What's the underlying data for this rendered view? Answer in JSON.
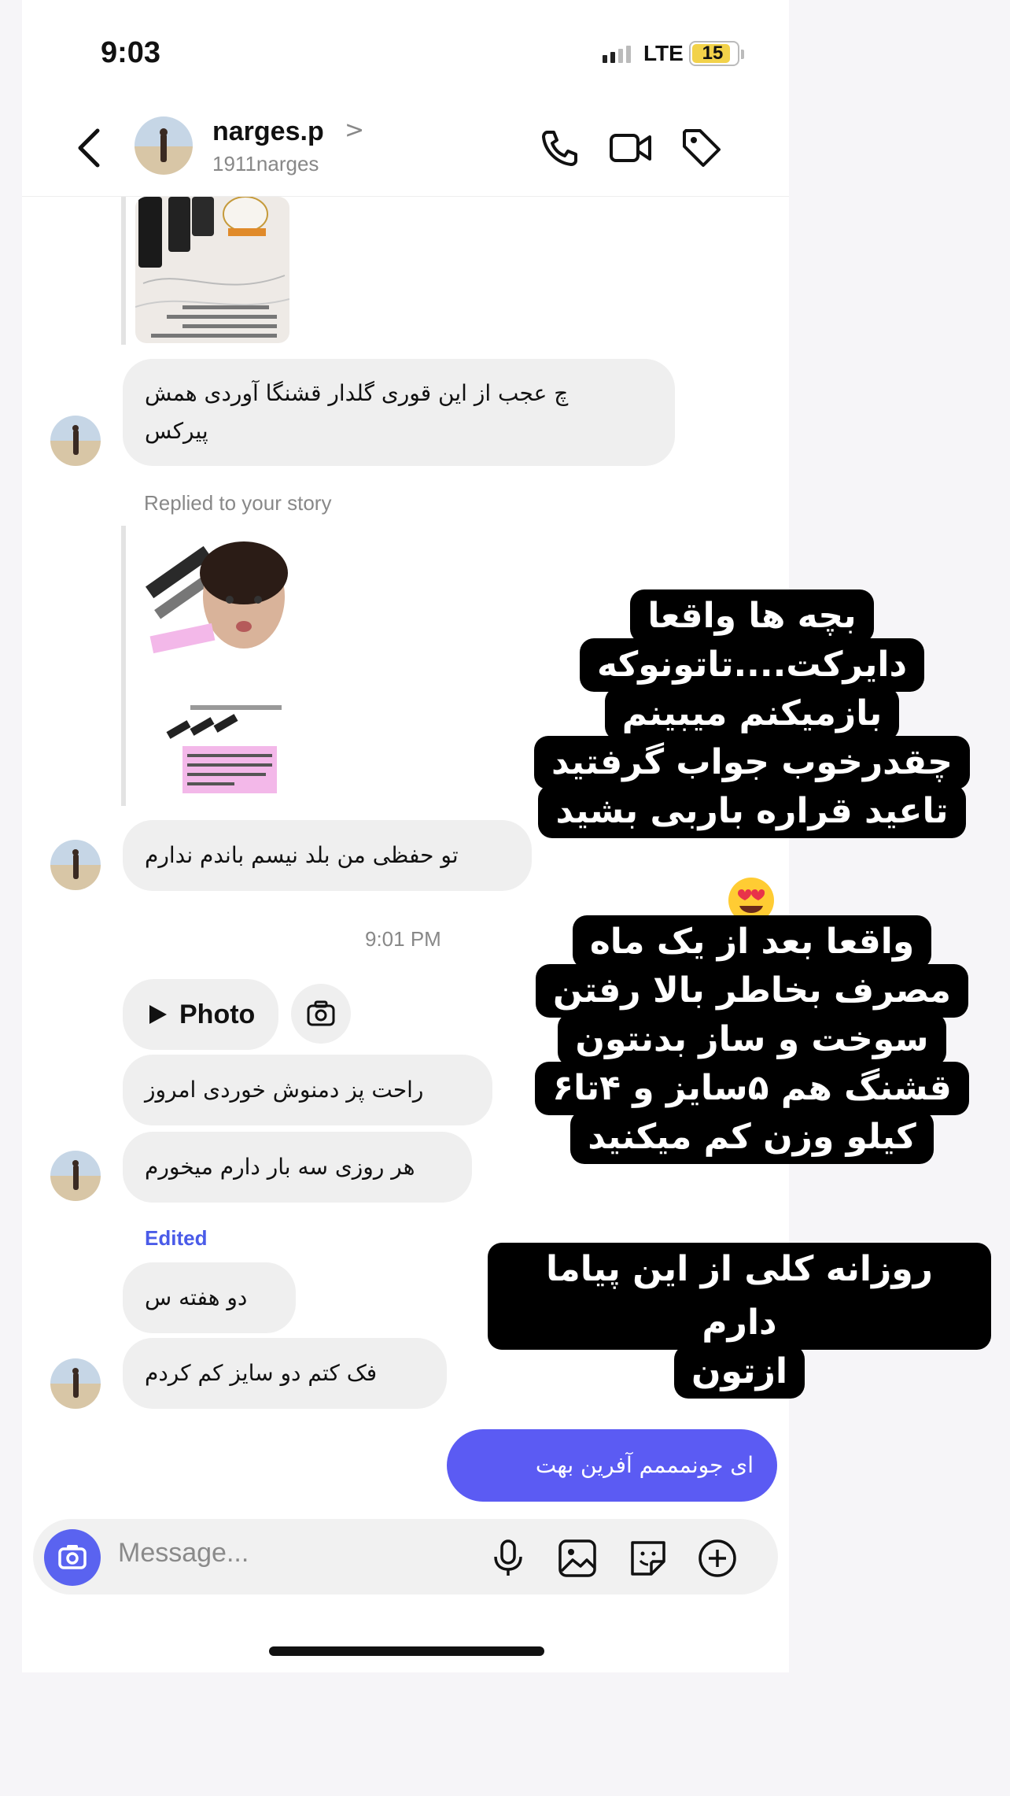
{
  "status_bar": {
    "time": "9:03",
    "network": "LTE",
    "battery": "15"
  },
  "header": {
    "name": "narges.p",
    "chevron": ">",
    "username": "1911narges"
  },
  "messages": {
    "msg1": "چ عجب از این قوری گلدار قشنگا آوردی همش",
    "msg1b": "پیرکس",
    "replied_label": "Replied to your story",
    "msg2": "تو حفظی من بلد نیسم باندم ندارم",
    "timestamp": "9:01 PM",
    "photo_label": "Photo",
    "msg3": "راحت پز دمنوش خوردی امروز",
    "msg4": "هر روزی سه بار دارم میخورم",
    "edited_label": "Edited",
    "msg5": "دو هفته س",
    "msg6": "فک کتم دو سایز کم کردم",
    "sent1": "ای جونمممم آفرین بهت"
  },
  "composer": {
    "placeholder": "Message..."
  },
  "story_overlay": {
    "block1_line1": "بچه ها واقعا",
    "block1_line2": "دایرکت....تاتونوکه",
    "block1_line3": "بازمیکنم میبینم",
    "block1_line4": "چقدرخوب جواب گرفتید",
    "block1_line5": "تاعید قراره باربی بشید",
    "block2_line1": "واقعا بعد از یک ماه",
    "block2_line2": "مصرف بخاطر بالا رفتن",
    "block2_line3": "سوخت و ساز بدنتون",
    "block2_line4": "قشنگ هم ۵سایز و ۴تا۶",
    "block2_line5": "کیلو وزن کم میکنید",
    "block3_line1": "روزانه کلی از این پیاما دارم",
    "block3_line2": "ازتون",
    "emoji": "smiling-face-with-heart-eyes"
  },
  "colors": {
    "accent": "#5b5bf3",
    "bubble_gray": "#efefef",
    "overlay_black": "#000000"
  }
}
